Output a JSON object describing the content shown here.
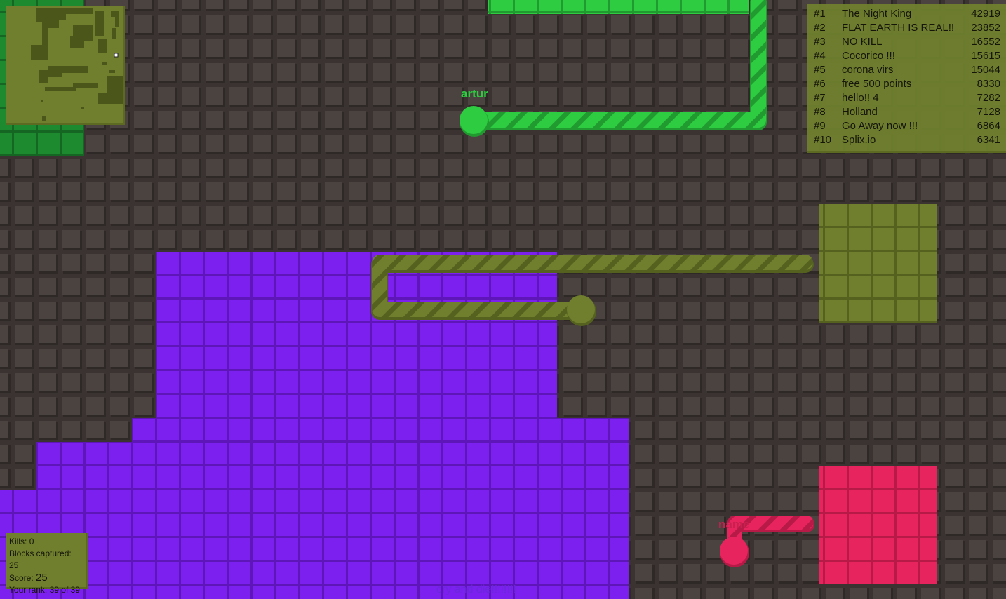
{
  "colors": {
    "background": "#3a3331",
    "tile": "#4a4340",
    "tile_shadow": "#2e2826",
    "purple": "#7b20ee",
    "purple_dark": "#5e16b8",
    "green": "#2ecc40",
    "green_dark": "#219b30",
    "darkgreen": "#1e8a30",
    "darkgreen_dark": "#156622",
    "olive": "#6f7f2d",
    "olive_dark": "#55621f",
    "pink": "#e8245e",
    "pink_dark": "#b81a48"
  },
  "leaderboard": [
    {
      "rank": "#1",
      "name": "The Night King",
      "score": "42919"
    },
    {
      "rank": "#2",
      "name": "FLAT EARTH IS REAL!!",
      "score": "23852"
    },
    {
      "rank": "#3",
      "name": "NO KILL",
      "score": "16552"
    },
    {
      "rank": "#4",
      "name": "Cocorico !!!",
      "score": "15615"
    },
    {
      "rank": "#5",
      "name": "corona virs",
      "score": "15044"
    },
    {
      "rank": "#6",
      "name": "free 500 points",
      "score": "8330"
    },
    {
      "rank": "#7",
      "name": "hello!! 4",
      "score": "7282"
    },
    {
      "rank": "#8",
      "name": "Holland",
      "score": "7128"
    },
    {
      "rank": "#9",
      "name": "Go Away now !!!",
      "score": "6864"
    },
    {
      "rank": "#10",
      "name": "Splix.io",
      "score": "6341"
    }
  ],
  "stats": {
    "kills_label": "Kills:",
    "kills": "0",
    "blocks_label": "Blocks captured:",
    "blocks": "25",
    "score_label": "Score:",
    "score": "25",
    "rank_label": "Your rank:",
    "rank": "39 of 39"
  },
  "players": [
    {
      "name": "artur",
      "color": "green"
    },
    {
      "name": "name",
      "color": "pink"
    }
  ],
  "message": "cry and die!!!!!!!!",
  "minimap": {
    "player_marker": "white-square"
  }
}
